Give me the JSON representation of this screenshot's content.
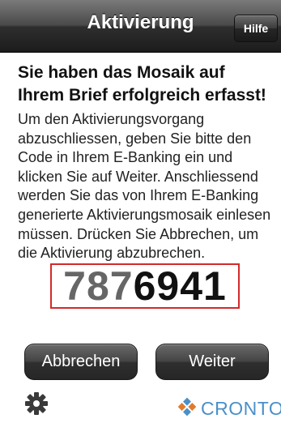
{
  "nav": {
    "title": "Aktivierung",
    "help_label": "Hilfe"
  },
  "content": {
    "headline": "Sie haben das Mosaik auf Ihrem Brief erfolgreich erfasst!",
    "body": "Um den Aktivierungsvorgang abzuschliessen, geben Sie bitte den Code in Ihrem E-Banking ein und klicken Sie auf Weiter. Anschliessend werden Sie das von Ihrem E-Banking generierte Aktivierungsmosaik einlesen müssen. Drücken Sie Abbrechen, um die Aktivierung abzubrechen.",
    "code_part1": "787",
    "code_part2": "6941"
  },
  "buttons": {
    "cancel_label": "Abbrechen",
    "next_label": "Weiter"
  },
  "footer": {
    "settings_icon": "gear-icon",
    "brand_logo_icon": "cronto-logo-icon",
    "brand_name": "CRONTO"
  },
  "colors": {
    "code_border": "#d42a2a",
    "brand": "#4a90c8"
  }
}
